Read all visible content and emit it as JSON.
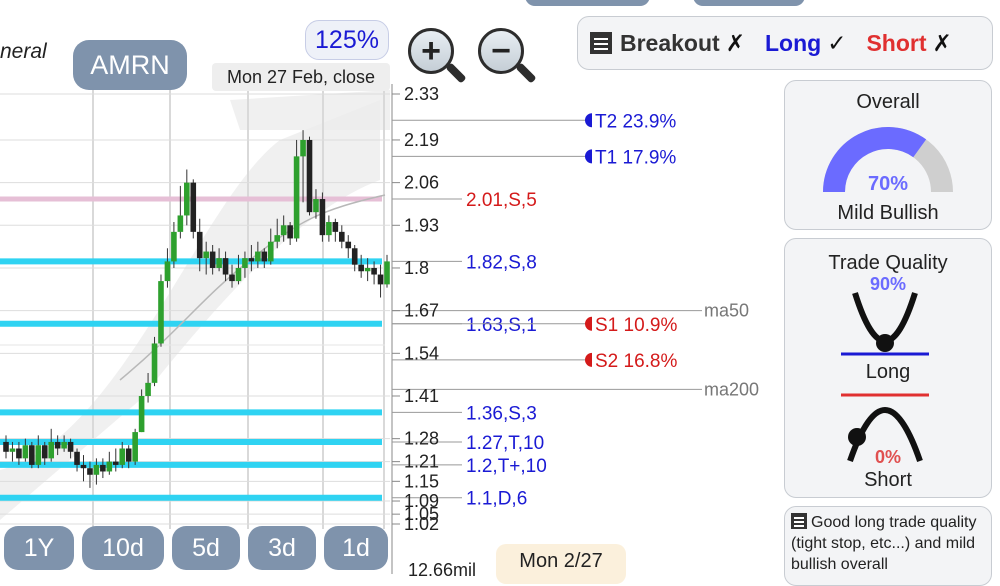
{
  "header": {
    "title_fragment": "neral",
    "ticker": "AMRN",
    "zoom_level": "125%",
    "date_label": "Mon 27 Feb, close"
  },
  "signals": {
    "breakout_label": "Breakout",
    "breakout_mark": "✗",
    "long_label": "Long",
    "long_mark": "✓",
    "short_label": "Short",
    "short_mark": "✗"
  },
  "overall": {
    "title": "Overall",
    "percent": "70%",
    "percent_value": 0.7,
    "verdict": "Mild Bullish"
  },
  "trade_quality": {
    "title": "Trade Quality",
    "long_percent": "90%",
    "long_label": "Long",
    "short_percent": "0%",
    "short_label": "Short"
  },
  "summary_note": "Good long trade quality (tight stop, etc...) and mild bullish overall",
  "range_buttons": [
    "1Y",
    "10d",
    "5d",
    "3d",
    "1d"
  ],
  "footer": {
    "volume_label": "12.66mil",
    "date_box": "Mon 2/27"
  },
  "colors": {
    "support_line": "#2fd3f2",
    "resistance_line": "#e6bfd6",
    "target_text": "#1a1ad4",
    "stop_text": "#d41a1a",
    "up_candle": "#2ea02e",
    "down_candle": "#222222",
    "button_bg": "#7f93ac",
    "gauge_fill": "#6b6bff",
    "gauge_bg": "#cfcfcf"
  },
  "chart_data": {
    "type": "candlestick",
    "ylim": [
      1.02,
      2.33
    ],
    "y_ticks": [
      "2.33",
      "2.19",
      "2.06",
      "1.93",
      "1.8",
      "1.67",
      "1.54",
      "1.41",
      "1.28",
      "1.21",
      "1.15",
      "1.09",
      "1.05",
      "1.02"
    ],
    "levels": [
      {
        "price": 2.01,
        "label": "2.01,S,5",
        "kind": "resistance"
      },
      {
        "price": 1.82,
        "label": "1.82,S,8",
        "kind": "support"
      },
      {
        "price": 1.63,
        "label": "1.63,S,1",
        "kind": "support"
      },
      {
        "price": 1.36,
        "label": "1.36,S,3",
        "kind": "support"
      },
      {
        "price": 1.27,
        "label": "1.27,T,10",
        "kind": "support"
      },
      {
        "price": 1.2,
        "label": "1.2,T+,10",
        "kind": "support"
      },
      {
        "price": 1.1,
        "label": "1.1,D,6",
        "kind": "support"
      }
    ],
    "targets": [
      {
        "label": "T2 23.9%",
        "price": 2.25
      },
      {
        "label": "T1 17.9%",
        "price": 2.14
      }
    ],
    "stops": [
      {
        "label": "S1 10.9%",
        "price": 1.63
      },
      {
        "label": "S2 16.8%",
        "price": 1.52
      }
    ],
    "moving_averages": [
      {
        "name": "ma50",
        "price": 1.67
      },
      {
        "name": "ma200",
        "price": 1.43
      }
    ],
    "candles": [
      [
        1.27,
        1.24,
        1.29,
        1.22
      ],
      [
        1.24,
        1.25,
        1.27,
        1.21
      ],
      [
        1.25,
        1.22,
        1.27,
        1.2
      ],
      [
        1.22,
        1.26,
        1.28,
        1.21
      ],
      [
        1.26,
        1.2,
        1.27,
        1.19
      ],
      [
        1.2,
        1.26,
        1.29,
        1.19
      ],
      [
        1.26,
        1.22,
        1.27,
        1.2
      ],
      [
        1.22,
        1.27,
        1.31,
        1.21
      ],
      [
        1.27,
        1.25,
        1.29,
        1.23
      ],
      [
        1.25,
        1.27,
        1.29,
        1.24
      ],
      [
        1.27,
        1.24,
        1.28,
        1.22
      ],
      [
        1.24,
        1.2,
        1.25,
        1.18
      ],
      [
        1.2,
        1.19,
        1.23,
        1.15
      ],
      [
        1.19,
        1.17,
        1.21,
        1.13
      ],
      [
        1.17,
        1.2,
        1.22,
        1.14
      ],
      [
        1.2,
        1.18,
        1.22,
        1.16
      ],
      [
        1.18,
        1.21,
        1.24,
        1.17
      ],
      [
        1.21,
        1.2,
        1.25,
        1.18
      ],
      [
        1.2,
        1.25,
        1.27,
        1.19
      ],
      [
        1.25,
        1.21,
        1.26,
        1.19
      ],
      [
        1.21,
        1.3,
        1.31,
        1.2
      ],
      [
        1.3,
        1.41,
        1.43,
        1.3
      ],
      [
        1.41,
        1.45,
        1.48,
        1.39
      ],
      [
        1.45,
        1.57,
        1.59,
        1.44
      ],
      [
        1.57,
        1.76,
        1.78,
        1.56
      ],
      [
        1.76,
        1.82,
        1.86,
        1.74
      ],
      [
        1.82,
        1.91,
        1.94,
        1.8
      ],
      [
        1.91,
        1.96,
        2.05,
        1.89
      ],
      [
        1.96,
        2.06,
        2.1,
        1.93
      ],
      [
        2.06,
        1.91,
        2.07,
        1.89
      ],
      [
        1.91,
        1.83,
        1.95,
        1.79
      ],
      [
        1.83,
        1.85,
        1.88,
        1.78
      ],
      [
        1.85,
        1.8,
        1.87,
        1.78
      ],
      [
        1.8,
        1.83,
        1.86,
        1.79
      ],
      [
        1.83,
        1.78,
        1.85,
        1.76
      ],
      [
        1.78,
        1.76,
        1.81,
        1.74
      ],
      [
        1.76,
        1.8,
        1.84,
        1.75
      ],
      [
        1.8,
        1.83,
        1.85,
        1.77
      ],
      [
        1.83,
        1.82,
        1.87,
        1.79
      ],
      [
        1.82,
        1.85,
        1.88,
        1.8
      ],
      [
        1.85,
        1.82,
        1.86,
        1.8
      ],
      [
        1.82,
        1.88,
        1.92,
        1.81
      ],
      [
        1.88,
        1.9,
        1.95,
        1.86
      ],
      [
        1.9,
        1.93,
        1.96,
        1.88
      ],
      [
        1.93,
        1.89,
        1.94,
        1.87
      ],
      [
        1.89,
        2.14,
        2.19,
        1.88
      ],
      [
        2.14,
        2.19,
        2.22,
        2.0
      ],
      [
        2.19,
        1.97,
        2.2,
        1.96
      ],
      [
        1.97,
        2.01,
        2.04,
        1.95
      ],
      [
        2.01,
        1.9,
        2.03,
        1.88
      ],
      [
        1.9,
        1.94,
        1.96,
        1.88
      ],
      [
        1.94,
        1.91,
        1.95,
        1.88
      ],
      [
        1.91,
        1.88,
        1.93,
        1.86
      ],
      [
        1.88,
        1.86,
        1.9,
        1.83
      ],
      [
        1.86,
        1.81,
        1.87,
        1.79
      ],
      [
        1.81,
        1.79,
        1.84,
        1.77
      ],
      [
        1.79,
        1.8,
        1.83,
        1.76
      ],
      [
        1.8,
        1.78,
        1.82,
        1.75
      ],
      [
        1.78,
        1.75,
        1.81,
        1.71
      ],
      [
        1.75,
        1.82,
        1.84,
        1.74
      ]
    ]
  }
}
